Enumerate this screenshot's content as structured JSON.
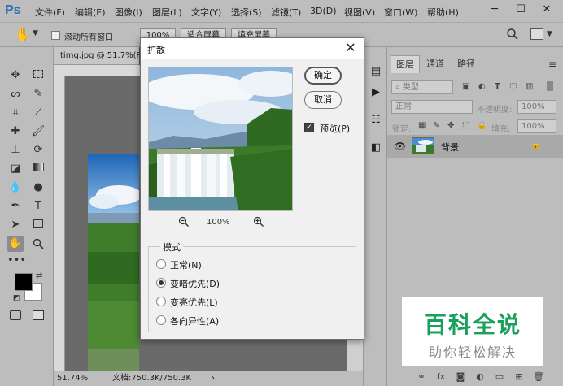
{
  "app": {
    "logo": "Ps"
  },
  "menu": [
    "文件(F)",
    "编辑(E)",
    "图像(I)",
    "图层(L)",
    "文字(Y)",
    "选择(S)",
    "滤镜(T)",
    "3D(D)",
    "视图(V)",
    "窗口(W)",
    "帮助(H)"
  ],
  "window_controls": {
    "minimize": "─",
    "maximize": "☐",
    "close": "✕"
  },
  "options": {
    "tool_icon": "hand-icon",
    "scroll_all_windows": "滚动所有窗口",
    "zoom_100": "100%",
    "fit_screen": "适合屏幕",
    "fill_screen": "填充屏幕"
  },
  "document": {
    "tab_label": "timg.jpg @ 51.7%(R",
    "zoom": "51.74%",
    "doc_size": "文档:750.3K/750.3K"
  },
  "dialog": {
    "title": "扩散",
    "ok": "确定",
    "cancel": "取消",
    "preview_label": "预览(P)",
    "preview_checked": true,
    "zoom_level": "100%",
    "mode_group": "模式",
    "modes": [
      {
        "label": "正常(N)",
        "checked": false
      },
      {
        "label": "变暗优先(D)",
        "checked": true
      },
      {
        "label": "变亮优先(L)",
        "checked": false
      },
      {
        "label": "各向异性(A)",
        "checked": false
      }
    ]
  },
  "layers_panel": {
    "tabs": [
      "图层",
      "通道",
      "路径"
    ],
    "filter_type": "类型",
    "blend_mode": "正常",
    "opacity_label": "不透明度:",
    "opacity_value": "100%",
    "lock_label": "锁定:",
    "fill_label": "填充:",
    "fill_value": "100%",
    "layer_name": "背景"
  },
  "watermark": {
    "title": "百科全说",
    "subtitle": "助你轻松解决"
  }
}
